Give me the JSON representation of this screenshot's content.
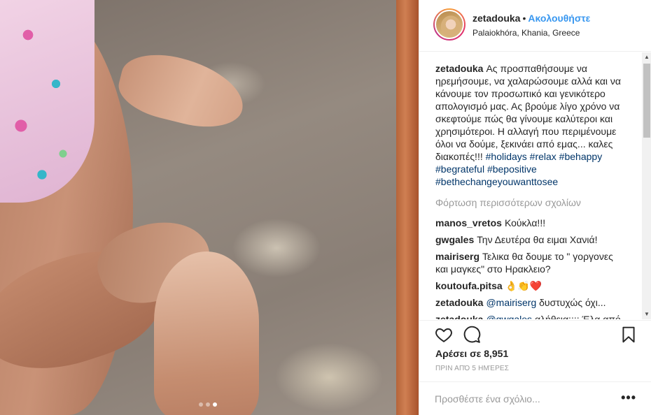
{
  "header": {
    "username": "zetadouka",
    "separator": "•",
    "follow_label": "Ακολουθήστε",
    "location": "Palaiokhóra, Khania, Greece"
  },
  "caption": {
    "username": "zetadouka",
    "text": "Ας προσπαθήσουμε να ηρεμήσουμε, να χαλαρώσουμε αλλά και να κάνουμε τον προσωπικό και γενικότερο απολογισμό μας. Ας βρούμε λίγο χρόνο να σκεφτούμε πώς θα γίνουμε καλύτεροι και χρησιμότεροι. Η αλλαγή που περιμένουμε όλοι να δούμε, ξεκινάει από εμας... καλες διακοπές!!!",
    "hashtags": "#holidays #relax #behappy #begrateful #bepositive #bethechangeyouwanttosee"
  },
  "load_more_label": "Φόρτωση περισσότερων σχολίων",
  "comments": [
    {
      "username": "manos_vretos",
      "mention": "",
      "text": "Κούκλα!!!"
    },
    {
      "username": "gwgales",
      "mention": "",
      "text": "Την Δευτέρα θα ειμαι Χανιά!"
    },
    {
      "username": "mairiserg",
      "mention": "",
      "text": "Τελικα θα δουμε το \" γοργονες και μαγκες\" στο Ηρακλειο?"
    },
    {
      "username": "koutoufa.pitsa",
      "mention": "",
      "text": "👌👏❤️"
    },
    {
      "username": "zetadouka",
      "mention": "@mairiserg",
      "text": "δυστυχώς όχι..."
    },
    {
      "username": "zetadouka",
      "mention": "@gwgales",
      "text": "αλήθεια:::: Έλα από"
    }
  ],
  "icons": {
    "like": "heart-icon",
    "comment": "comment-bubble-icon",
    "save": "bookmark-icon",
    "more": "more-options-icon"
  },
  "likes_label": "Αρέσει σε 8,951",
  "timestamp": "ΠΡΙΝ ΑΠΌ 5 ΗΜΈΡΕΣ",
  "add_comment_placeholder": "Προσθέστε ένα σχόλιο...",
  "more_label": "•••",
  "scrollbar": {
    "up": "▲",
    "down": "▼"
  },
  "carousel": {
    "count": 3,
    "active_index": 2
  },
  "colors": {
    "link_blue": "#3897f0",
    "hashtag_blue": "#003569",
    "muted_gray": "#999999",
    "like_red": "#ed4956"
  }
}
